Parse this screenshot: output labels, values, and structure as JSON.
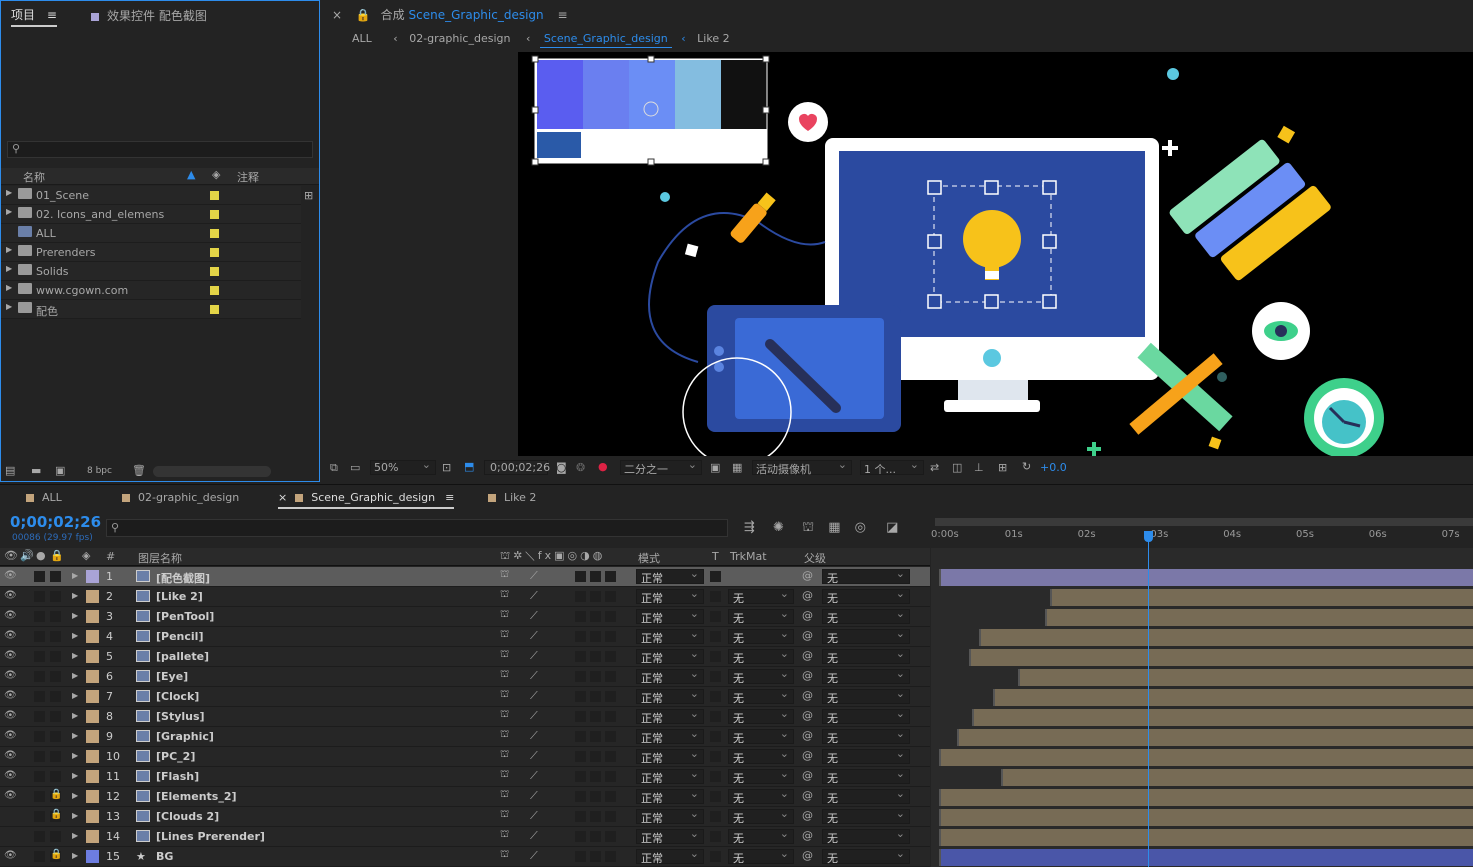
{
  "project_panel": {
    "tab_project": "项目",
    "tab_effects": "效果控件 配色截图",
    "search_placeholder": "",
    "col_name": "名称",
    "col_comment": "注释",
    "items": [
      {
        "label": "01_Scene",
        "type": "folder"
      },
      {
        "label": "02. Icons_and_elemens",
        "type": "folder"
      },
      {
        "label": "ALL",
        "type": "comp"
      },
      {
        "label": "Prerenders",
        "type": "folder"
      },
      {
        "label": "Solids",
        "type": "folder"
      },
      {
        "label": "www.cgown.com",
        "type": "folder"
      },
      {
        "label": "配色",
        "type": "folder"
      }
    ],
    "bpc": "8 bpc"
  },
  "comp_panel": {
    "tab_prefix": "合成",
    "tab_name": "Scene_Graphic_design",
    "crumbs": [
      "ALL",
      "02-graphic_design",
      "Scene_Graphic_design",
      "Like 2"
    ]
  },
  "viewer_toolbar": {
    "zoom": "50%",
    "timecode": "0;00;02;26",
    "resolution": "二分之一",
    "camera": "活动摄像机",
    "views": "1 个...",
    "exposure": "+0.0"
  },
  "timeline_tabs": [
    "ALL",
    "02-graphic_design",
    "Scene_Graphic_design",
    "Like 2"
  ],
  "timeline": {
    "timecode": "0;00;02;26",
    "frame_info": "00086 (29.97 fps)",
    "search_placeholder": "",
    "col_num": "#",
    "col_layer_name": "图层名称",
    "col_mode": "模式",
    "col_t": "T",
    "col_trkmat": "TrkMat",
    "col_parent": "父级",
    "ruler": [
      "0:00s",
      "01s",
      "02s",
      "03s",
      "04s",
      "05s",
      "06s",
      "07s"
    ],
    "playhead_seconds": 2.87,
    "layers": [
      {
        "num": "1",
        "name": "[配色截图]",
        "mode": "正常",
        "trkmat": "",
        "parent": "无",
        "start": 0.0,
        "color": "#a9a3d6",
        "selected": true
      },
      {
        "num": "2",
        "name": "[Like 2]",
        "mode": "正常",
        "trkmat": "无",
        "parent": "无",
        "start": 1.52,
        "color": "#c3a47c"
      },
      {
        "num": "3",
        "name": "[PenTool]",
        "mode": "正常",
        "trkmat": "无",
        "parent": "无",
        "start": 1.45,
        "color": "#c3a47c"
      },
      {
        "num": "4",
        "name": "[Pencil]",
        "mode": "正常",
        "trkmat": "无",
        "parent": "无",
        "start": 0.55,
        "color": "#c3a47c"
      },
      {
        "num": "5",
        "name": "[pallete]",
        "mode": "正常",
        "trkmat": "无",
        "parent": "无",
        "start": 0.41,
        "color": "#c3a47c"
      },
      {
        "num": "6",
        "name": "[Eye]",
        "mode": "正常",
        "trkmat": "无",
        "parent": "无",
        "start": 1.08,
        "color": "#c3a47c"
      },
      {
        "num": "7",
        "name": "[Clock]",
        "mode": "正常",
        "trkmat": "无",
        "parent": "无",
        "start": 0.74,
        "color": "#c3a47c"
      },
      {
        "num": "8",
        "name": "[Stylus]",
        "mode": "正常",
        "trkmat": "无",
        "parent": "无",
        "start": 0.45,
        "color": "#c3a47c"
      },
      {
        "num": "9",
        "name": "[Graphic]",
        "mode": "正常",
        "trkmat": "无",
        "parent": "无",
        "start": 0.25,
        "color": "#c3a47c"
      },
      {
        "num": "10",
        "name": "[PC_2]",
        "mode": "正常",
        "trkmat": "无",
        "parent": "无",
        "start": 0.0,
        "color": "#c3a47c"
      },
      {
        "num": "11",
        "name": "[Flash]",
        "mode": "正常",
        "trkmat": "无",
        "parent": "无",
        "start": 0.85,
        "color": "#c3a47c"
      },
      {
        "num": "12",
        "name": "[Elements_2]",
        "mode": "正常",
        "trkmat": "无",
        "parent": "无",
        "start": 0.0,
        "color": "#c3a47c"
      },
      {
        "num": "13",
        "name": "[Clouds 2]",
        "mode": "正常",
        "trkmat": "无",
        "parent": "无",
        "start": 0.0,
        "color": "#c3a47c"
      },
      {
        "num": "14",
        "name": "[Lines Prerender]",
        "mode": "正常",
        "trkmat": "无",
        "parent": "无",
        "start": 0.0,
        "color": "#c3a47c"
      },
      {
        "num": "15",
        "name": "BG",
        "mode": "正常",
        "trkmat": "无",
        "parent": "无",
        "start": 0.0,
        "color": "#6d7de0",
        "bg": true
      }
    ]
  }
}
